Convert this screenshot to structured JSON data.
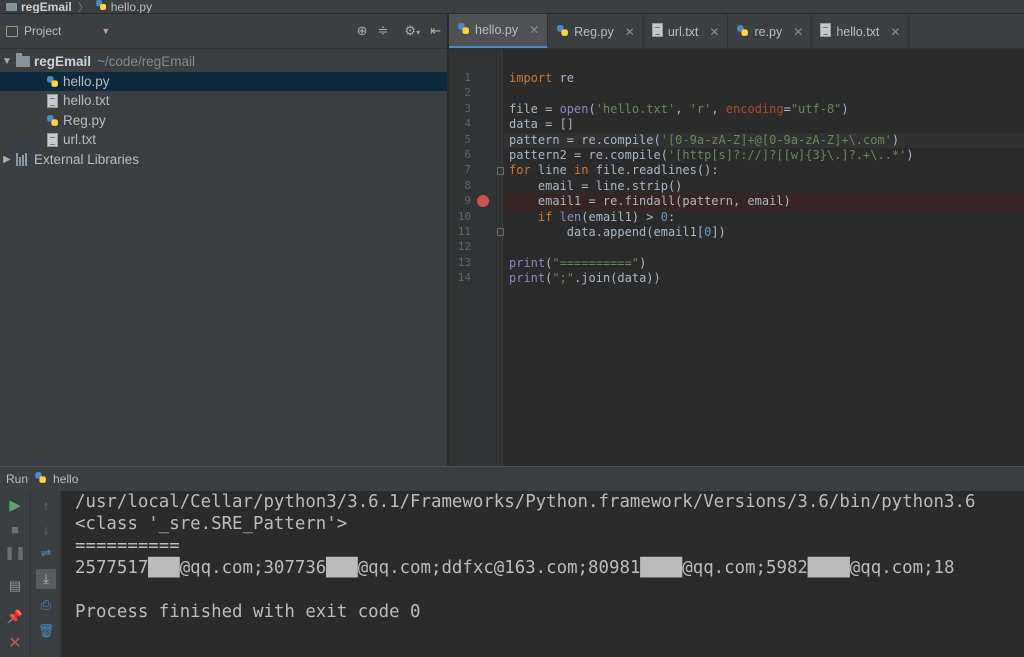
{
  "breadcrumb": {
    "project": "regEmail",
    "file": "hello.py"
  },
  "project_panel": {
    "selector_label": "Project",
    "root": {
      "name": "regEmail",
      "path": "~/code/regEmail"
    },
    "files": [
      "hello.py",
      "hello.txt",
      "Reg.py",
      "url.txt"
    ],
    "external": "External Libraries",
    "selected_index": 0
  },
  "tabs": [
    {
      "label": "hello.py",
      "active": true,
      "icon": "python-file-icon"
    },
    {
      "label": "Reg.py",
      "active": false,
      "icon": "python-file-icon"
    },
    {
      "label": "url.txt",
      "active": false,
      "icon": "text-file-icon"
    },
    {
      "label": "re.py",
      "active": false,
      "icon": "python-file-icon"
    },
    {
      "label": "hello.txt",
      "active": false,
      "icon": "text-file-icon"
    }
  ],
  "editor": {
    "line_numbers": [
      "1",
      "2",
      "3",
      "4",
      "5",
      "6",
      "7",
      "8",
      "9",
      "10",
      "11",
      "12",
      "13",
      "14"
    ],
    "breakpoint_line": 9,
    "lines": [
      "import re",
      "",
      "file = open('hello.txt', 'r', encoding=\"utf-8\")",
      "data = []",
      "pattern = re.compile('[0-9a-zA-Z]+@[0-9a-zA-Z]+\\.com')",
      "pattern2 = re.compile('[http[s]?://]?[[w]{3}\\.]?.+\\..*')",
      "for line in file.readlines():",
      "    email = line.strip()",
      "    email1 = re.findall(pattern, email)",
      "    if len(email1) > 0:",
      "        data.append(email1[0])",
      "",
      "print(\"==========\")",
      "print(\";\".join(data))"
    ]
  },
  "run": {
    "label": "Run",
    "config": "hello",
    "output": [
      "/usr/local/Cellar/python3/3.6.1/Frameworks/Python.framework/Versions/3.6/bin/python3.6",
      "<class '_sre.SRE_Pattern'>",
      "==========",
      "2577517███@qq.com;307736███@qq.com;ddfxc@163.com;80981████@qq.com;5982████@qq.com;18",
      "",
      "Process finished with exit code 0"
    ]
  },
  "colors": {
    "keyword": "#cc7832",
    "string": "#6a8759",
    "number": "#6897bb",
    "breakpoint": "#c75450",
    "selection": "#0d293e",
    "active_tab_underline": "#4a88c7"
  }
}
